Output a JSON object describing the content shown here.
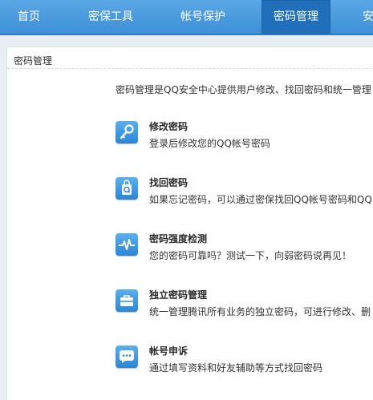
{
  "nav": {
    "items": [
      {
        "label": "首页"
      },
      {
        "label": "密保工具"
      },
      {
        "label": "帐号保护"
      },
      {
        "label": "密码管理"
      },
      {
        "label": "安"
      }
    ],
    "active_index": 3
  },
  "panel": {
    "title": "密码管理",
    "intro": "密码管理是QQ安全中心提供用户修改、找回密码和统一管理"
  },
  "items": [
    {
      "title": "修改密码",
      "desc": "登录后修改您的QQ帐号密码",
      "icon": "key-icon"
    },
    {
      "title": "找回密码",
      "desc": "如果忘记密码，可以通过密保找回QQ帐号密码和QQ",
      "icon": "shopping-bag-q-icon"
    },
    {
      "title": "密码强度检测",
      "desc": "您的密码可靠吗？测试一下，向弱密码说再见！",
      "icon": "pulse-icon"
    },
    {
      "title": "独立密码管理",
      "desc": "统一管理腾讯所有业务的独立密码，可进行修改、删",
      "icon": "briefcase-icon"
    },
    {
      "title": "帐号申诉",
      "desc": "通过填写资料和好友辅助等方式找回密码",
      "icon": "chat-bubble-icon"
    }
  ],
  "colors": {
    "nav_bg": "#4a9be0",
    "nav_active": "#1f6fba",
    "icon_blue": "#2f8ddc"
  }
}
